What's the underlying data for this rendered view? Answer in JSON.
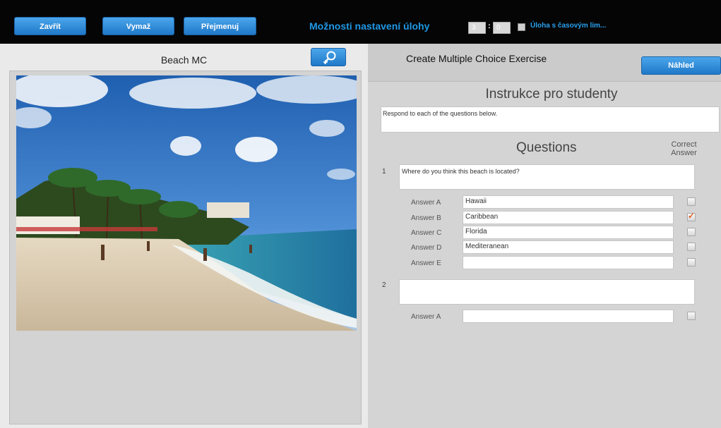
{
  "toolbar": {
    "close_label": "Zavřít",
    "delete_label": "Vymaž",
    "rename_label": "Přejmenuj",
    "settings_title": "Možnosti nastavení úlohy",
    "time_minutes": "3",
    "time_seconds": "0",
    "time_limit_label": "Úloha s časovým lim...",
    "time_limit_checked": false
  },
  "left": {
    "title": "Beach MC",
    "zoom_icon": "zoom-in-icon"
  },
  "right": {
    "header_title": "Create Multiple Choice Exercise",
    "preview_label": "Náhled",
    "instructions_heading": "Instrukce pro studenty",
    "instructions_text": "Respond to each of the questions below.",
    "questions_heading": "Questions",
    "correct_heading": "Correct Answer",
    "questions": [
      {
        "number": "1",
        "text": "Where do you think this beach is located?",
        "answers": [
          {
            "label": "Answer A",
            "value": "Hawaii",
            "correct": false
          },
          {
            "label": "Answer B",
            "value": "Caribbean",
            "correct": true
          },
          {
            "label": "Answer C",
            "value": "Florida",
            "correct": false
          },
          {
            "label": "Answer D",
            "value": "Mediteranean",
            "correct": false
          },
          {
            "label": "Answer E",
            "value": "",
            "correct": false
          }
        ]
      },
      {
        "number": "2",
        "text": "",
        "answers": [
          {
            "label": "Answer A",
            "value": "",
            "correct": false
          }
        ]
      }
    ]
  },
  "colors": {
    "accent": "#1e98e6",
    "button": "#2d8ad8",
    "check": "#e0602a"
  }
}
